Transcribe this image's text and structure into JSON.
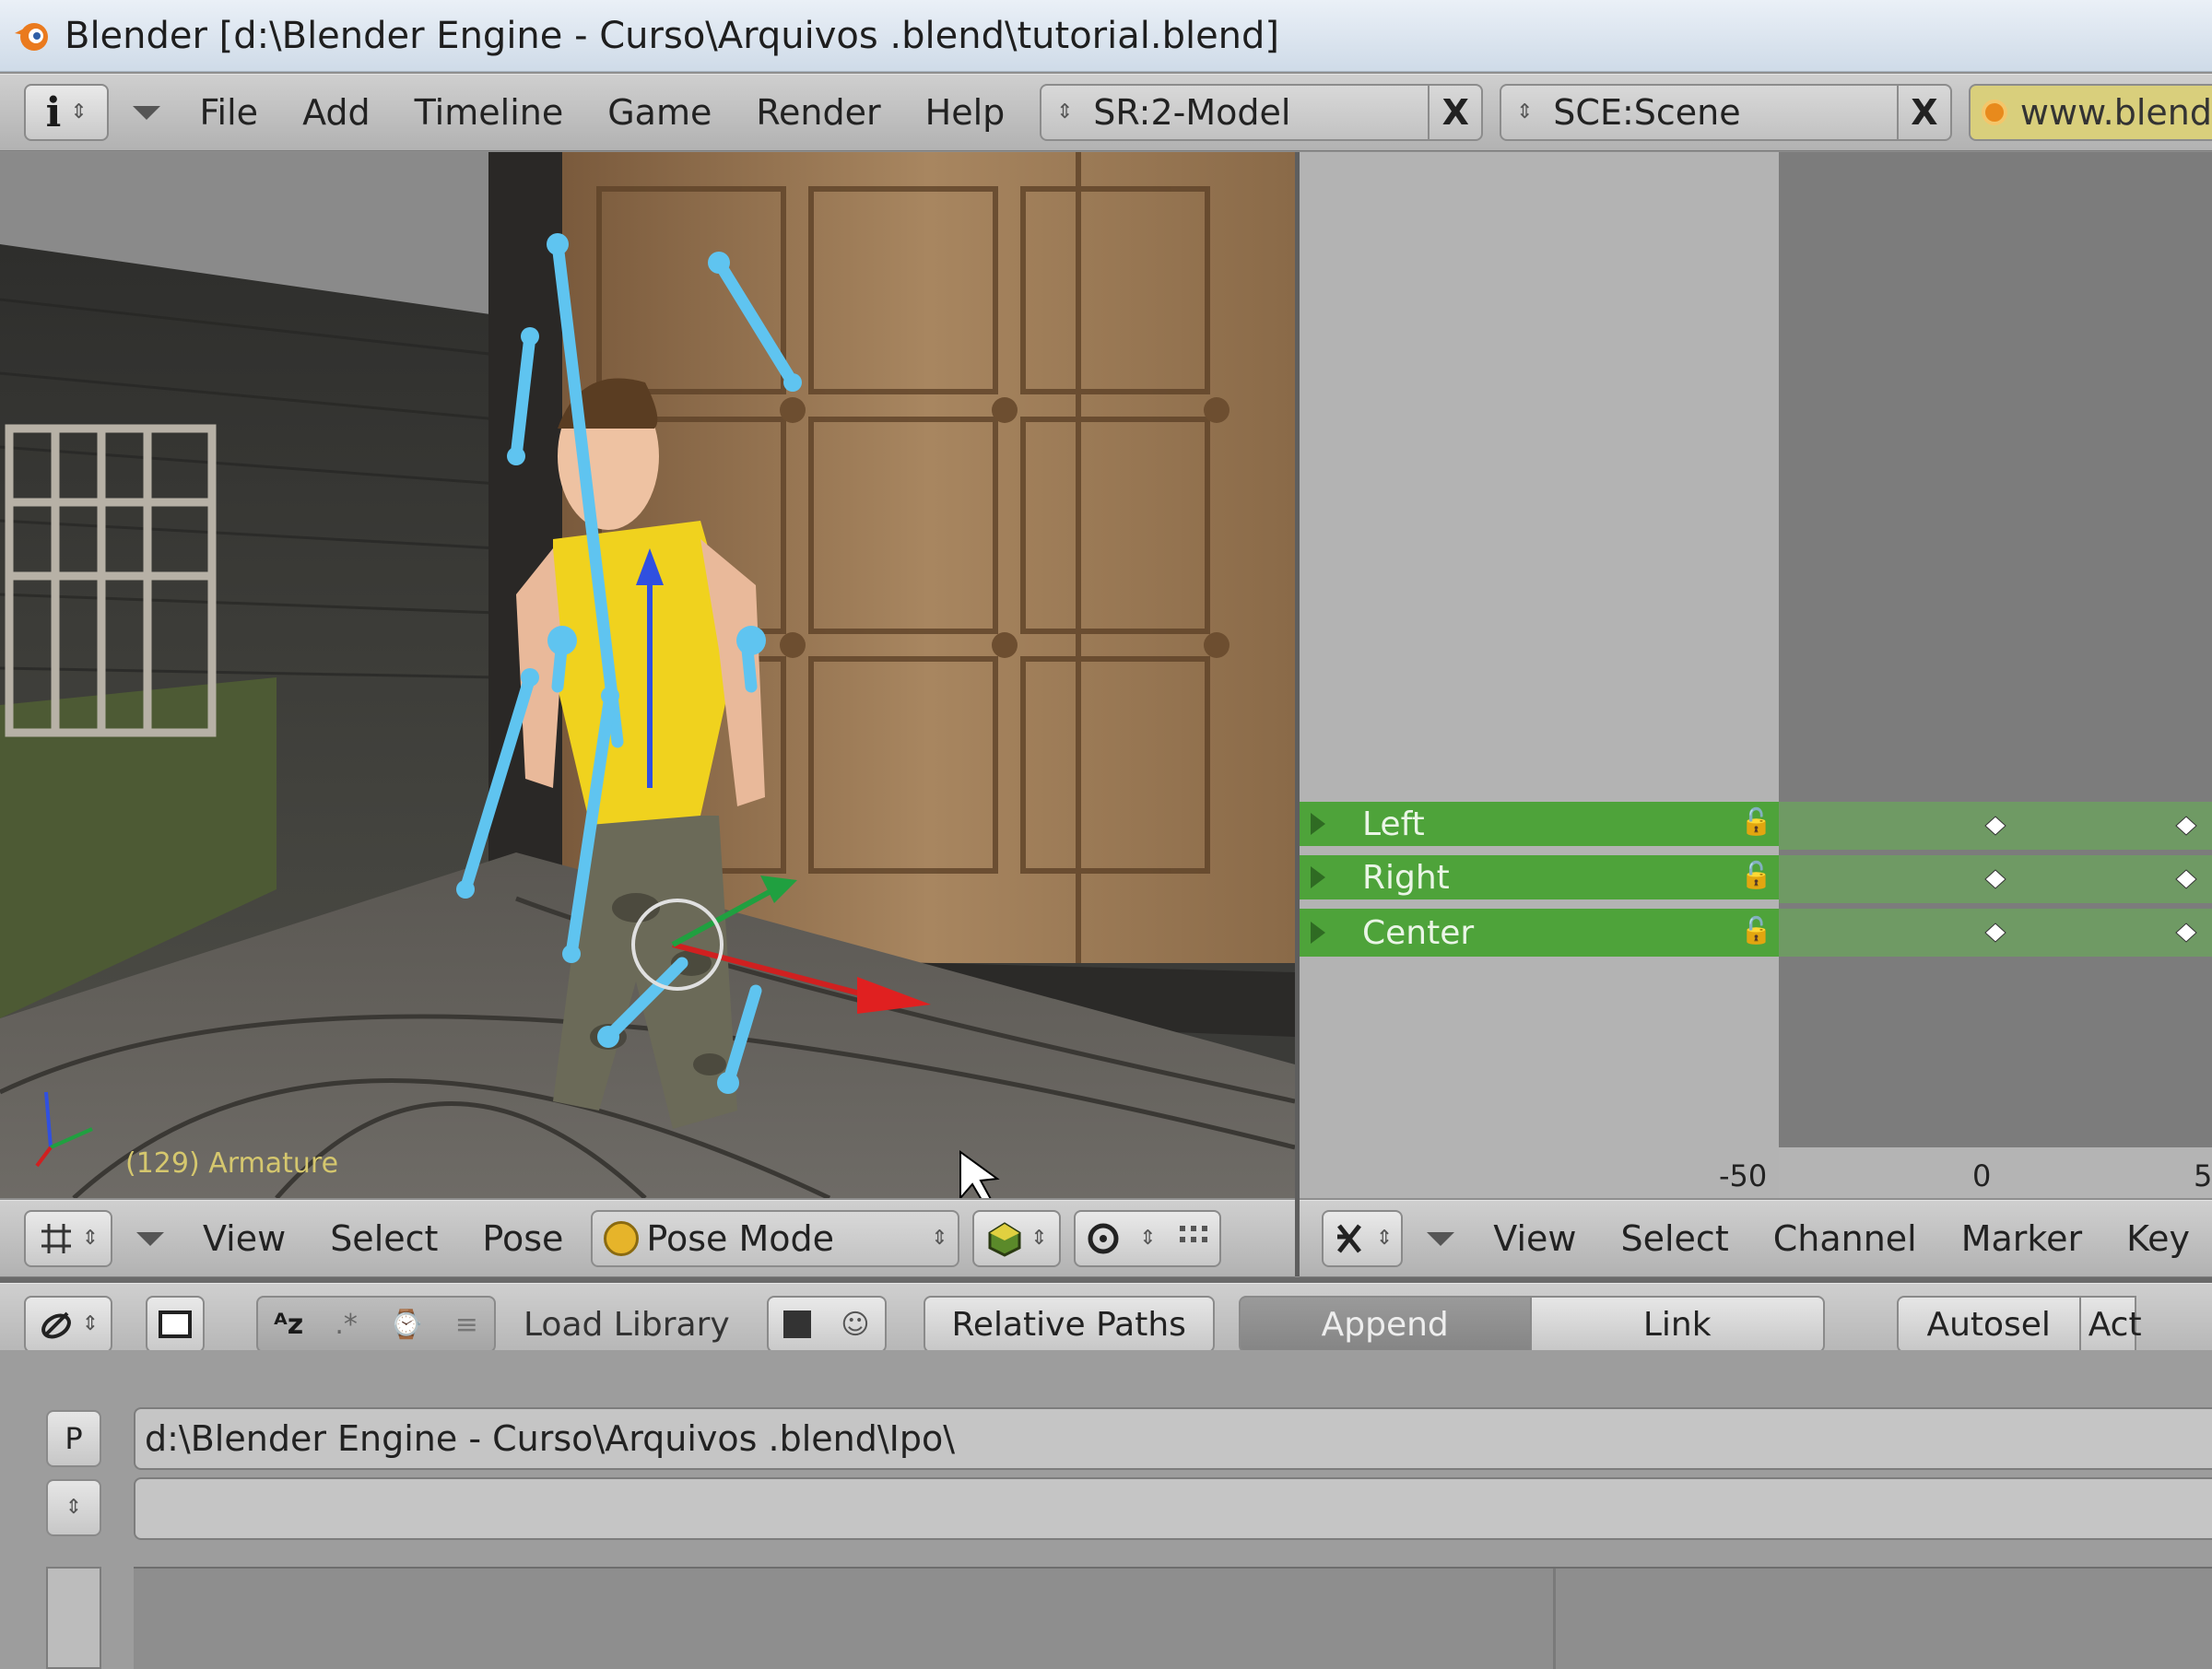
{
  "window": {
    "title": "Blender [d:\\Blender Engine - Curso\\Arquivos .blend\\tutorial.blend]"
  },
  "top_header": {
    "menus": [
      "File",
      "Add",
      "Timeline",
      "Game",
      "Render",
      "Help"
    ],
    "screen_field": "SR:2-Model",
    "scene_field": "SCE:Scene",
    "website": "www.blend",
    "close_glyph": "X"
  },
  "viewport": {
    "overlay_label": "(129) Armature"
  },
  "action_editor": {
    "channels": [
      {
        "label": "Left"
      },
      {
        "label": "Right"
      },
      {
        "label": "Center"
      }
    ],
    "ruler_ticks": [
      "-50",
      "0",
      "5"
    ]
  },
  "viewport_header": {
    "menus": [
      "View",
      "Select",
      "Pose"
    ],
    "mode": "Pose Mode"
  },
  "action_header": {
    "menus": [
      "View",
      "Select",
      "Channel",
      "Marker",
      "Key"
    ]
  },
  "file_header": {
    "load_library": "Load Library",
    "relative_paths": "Relative Paths",
    "append": "Append",
    "link": "Link",
    "autosel": "Autosel",
    "act": "Act"
  },
  "file_browser": {
    "parent_button": "P",
    "path": "d:\\Blender Engine - Curso\\Arquivos .blend\\Ipo\\",
    "filename": ""
  },
  "colors": {
    "channel_green": "#4ea33a",
    "bone_blue": "#5fc4f0",
    "shirt_yellow": "#f0d21e"
  }
}
